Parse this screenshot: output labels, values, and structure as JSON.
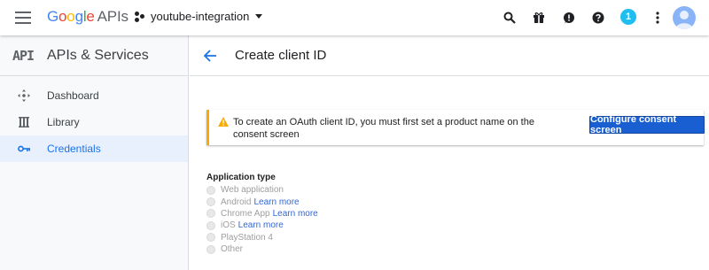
{
  "topbar": {
    "logo_google": [
      "G",
      "o",
      "o",
      "g",
      "l",
      "e"
    ],
    "logo_apis": "APIs",
    "project_name": "youtube-integration",
    "notification_count": "1",
    "icons": [
      "menu-icon",
      "search-icon",
      "gift-icon",
      "feedback-icon",
      "help-icon",
      "more-vert-icon",
      "account-avatar"
    ]
  },
  "sidebar": {
    "logo": "API",
    "title": "APIs & Services",
    "items": [
      {
        "label": "Dashboard",
        "icon": "dashboard-icon",
        "active": false
      },
      {
        "label": "Library",
        "icon": "library-icon",
        "active": false
      },
      {
        "label": "Credentials",
        "icon": "key-icon",
        "active": true
      }
    ]
  },
  "main": {
    "title": "Create client ID",
    "alert": {
      "text": "To create an OAuth client ID, you must first set a product name on the consent screen",
      "button": "Configure consent screen"
    },
    "app_type": {
      "label": "Application type",
      "options": [
        {
          "label": "Web application",
          "link": ""
        },
        {
          "label": "Android",
          "link": "Learn more"
        },
        {
          "label": "Chrome App",
          "link": "Learn more"
        },
        {
          "label": "iOS",
          "link": "Learn more"
        },
        {
          "label": "PlayStation 4",
          "link": ""
        },
        {
          "label": "Other",
          "link": ""
        }
      ]
    }
  },
  "colors": {
    "accent": "#1a73e8",
    "button": "#1a5fd1",
    "warning": "#f9ab00",
    "active_nav_bg": "#e8f0fe",
    "badge": "#1ebff0"
  }
}
